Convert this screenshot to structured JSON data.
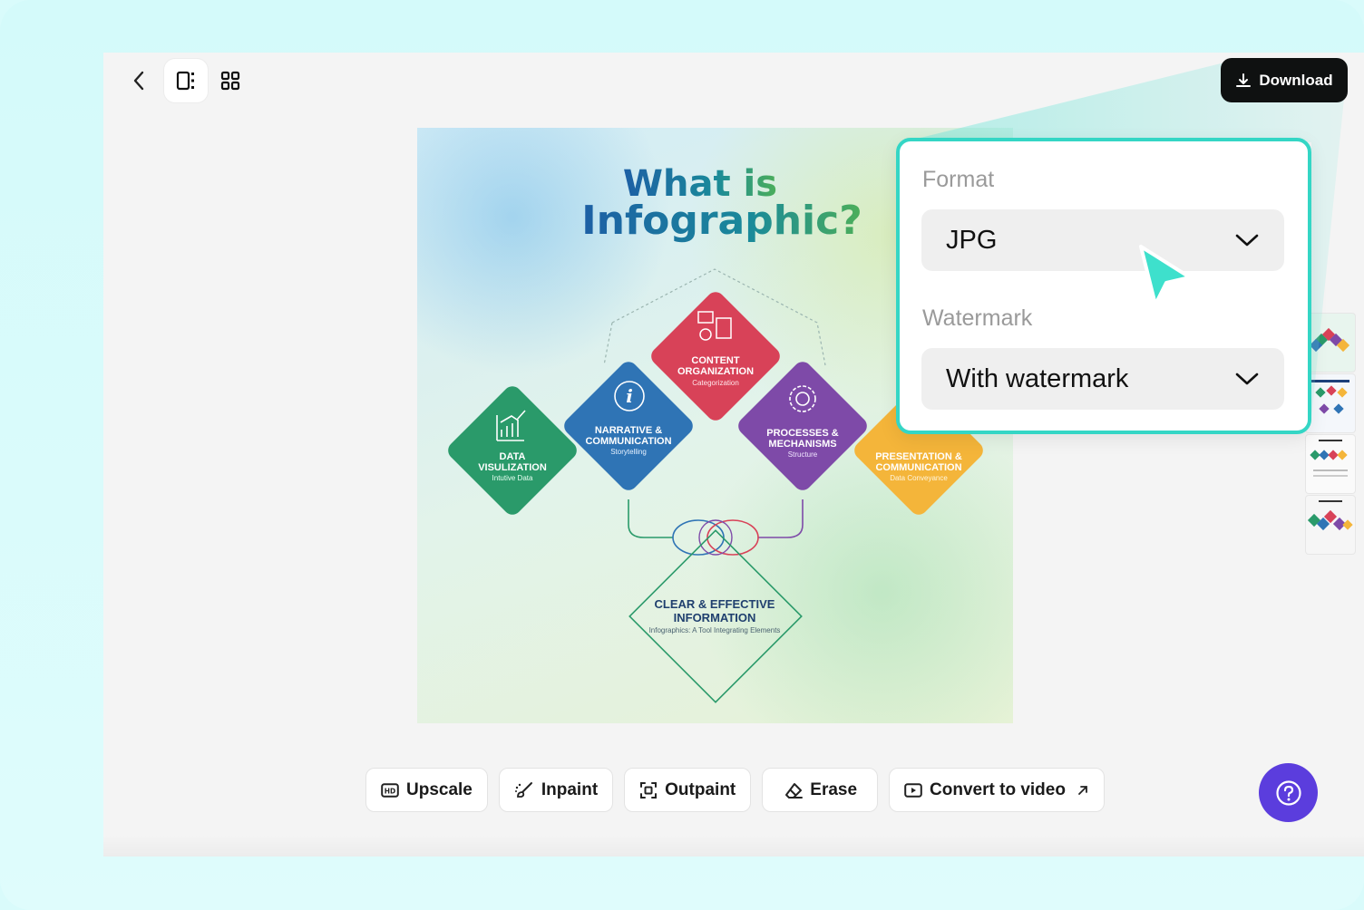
{
  "toolbar": {
    "back_icon": "chevron-left-icon",
    "view_single_icon": "single-view-icon",
    "view_grid_icon": "grid-view-icon",
    "download_label": "Download"
  },
  "infographic": {
    "title_line1": "What is",
    "title_line2": "Infographic?",
    "center": {
      "title1": "CLEAR & EFFECTIVE",
      "title2": "INFORMATION",
      "subtitle": "Infographics: A Tool Integrating Elements"
    },
    "diamonds": [
      {
        "line1": "DATA",
        "line2": "VISULIZATION",
        "sub": "Intutive Data",
        "color": "#2a9a6a"
      },
      {
        "line1": "NARRATIVE &",
        "line2": "COMMUNICATION",
        "sub": "Storytelling",
        "color": "#2f74b5"
      },
      {
        "line1": "CONTENT",
        "line2": "ORGANIZATION",
        "sub": "Categorization",
        "color": "#d84258"
      },
      {
        "line1": "PROCESSES &",
        "line2": "MECHANISMS",
        "sub": "Structure",
        "color": "#7e4aa8"
      },
      {
        "line1": "PRESENTATION &",
        "line2": "COMMUNICATION",
        "sub": "Data Conveyance",
        "color": "#f4b53a"
      }
    ]
  },
  "tools": [
    {
      "label": "Upscale",
      "icon": "hd-icon"
    },
    {
      "label": "Inpaint",
      "icon": "brush-icon"
    },
    {
      "label": "Outpaint",
      "icon": "expand-frame-icon"
    },
    {
      "label": "Erase",
      "icon": "eraser-icon"
    },
    {
      "label": "Convert to video",
      "icon": "video-icon",
      "trailing_icon": "arrow-up-right-icon"
    }
  ],
  "popup": {
    "format_label": "Format",
    "format_value": "JPG",
    "watermark_label": "Watermark",
    "watermark_value": "With watermark"
  },
  "colors": {
    "accent": "#34d6c5",
    "help_button": "#5b3ddd",
    "download_bg": "#0f1111"
  }
}
